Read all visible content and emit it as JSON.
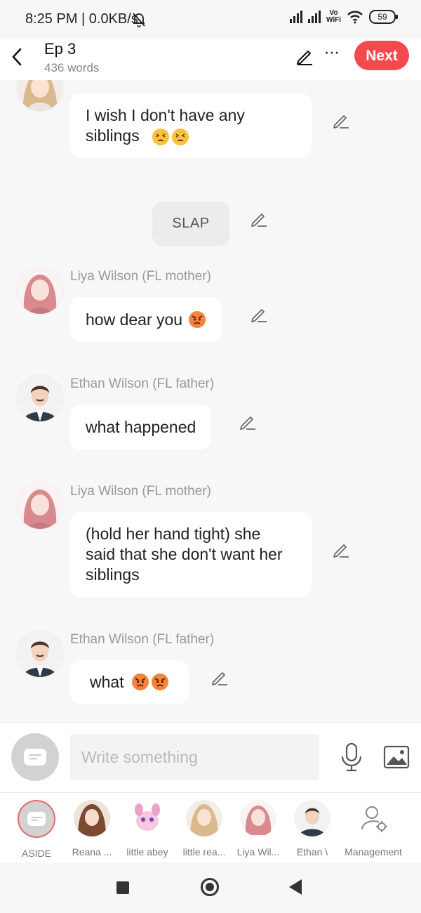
{
  "status_bar": {
    "time": "8:25 PM | 0.0KB/s",
    "vo_label": "Vo",
    "wifi_label": "WiFi",
    "battery": "59"
  },
  "header": {
    "title": "Ep 3",
    "word_count": "436 words",
    "next_label": "Next"
  },
  "chat": {
    "messages": [
      {
        "kind": "bubble",
        "text": "I wish I don't have any\nsiblings",
        "emojis": [
          "tired-face",
          "tired-face"
        ]
      },
      {
        "kind": "aside",
        "text": "SLAP"
      },
      {
        "kind": "bubble",
        "speaker": "Liya Wilson (FL mother)",
        "text": "how dear you",
        "emojis": [
          "angry-face"
        ]
      },
      {
        "kind": "bubble",
        "speaker": "Ethan Wilson (FL father)",
        "text": "what happened",
        "emojis": []
      },
      {
        "kind": "bubble",
        "speaker": "Liya Wilson (FL mother)",
        "text": "(hold her hand tight) she\nsaid that she don't want her\nsiblings",
        "emojis": []
      },
      {
        "kind": "bubble",
        "speaker": "Ethan Wilson (FL father)",
        "text": "what",
        "emojis": [
          "angry-face",
          "angry-face"
        ]
      }
    ]
  },
  "composer": {
    "placeholder": "Write something"
  },
  "characters": [
    {
      "label": "ASIDE",
      "icon": "aside-icon",
      "selected": true
    },
    {
      "label": "Reana ...",
      "icon": "reana-avatar"
    },
    {
      "label": "little abey",
      "icon": "little-abey-avatar"
    },
    {
      "label": "little rea...",
      "icon": "little-reana-avatar"
    },
    {
      "label": "Liya Wil...",
      "icon": "liya-avatar"
    },
    {
      "label": "Ethan \\",
      "icon": "ethan-avatar"
    },
    {
      "label": "Management",
      "icon": "management-icon"
    }
  ],
  "colors": {
    "accent": "#f44a4f",
    "background": "#f7f7f7",
    "bubble": "#ffffff",
    "muted_text": "#999999"
  }
}
